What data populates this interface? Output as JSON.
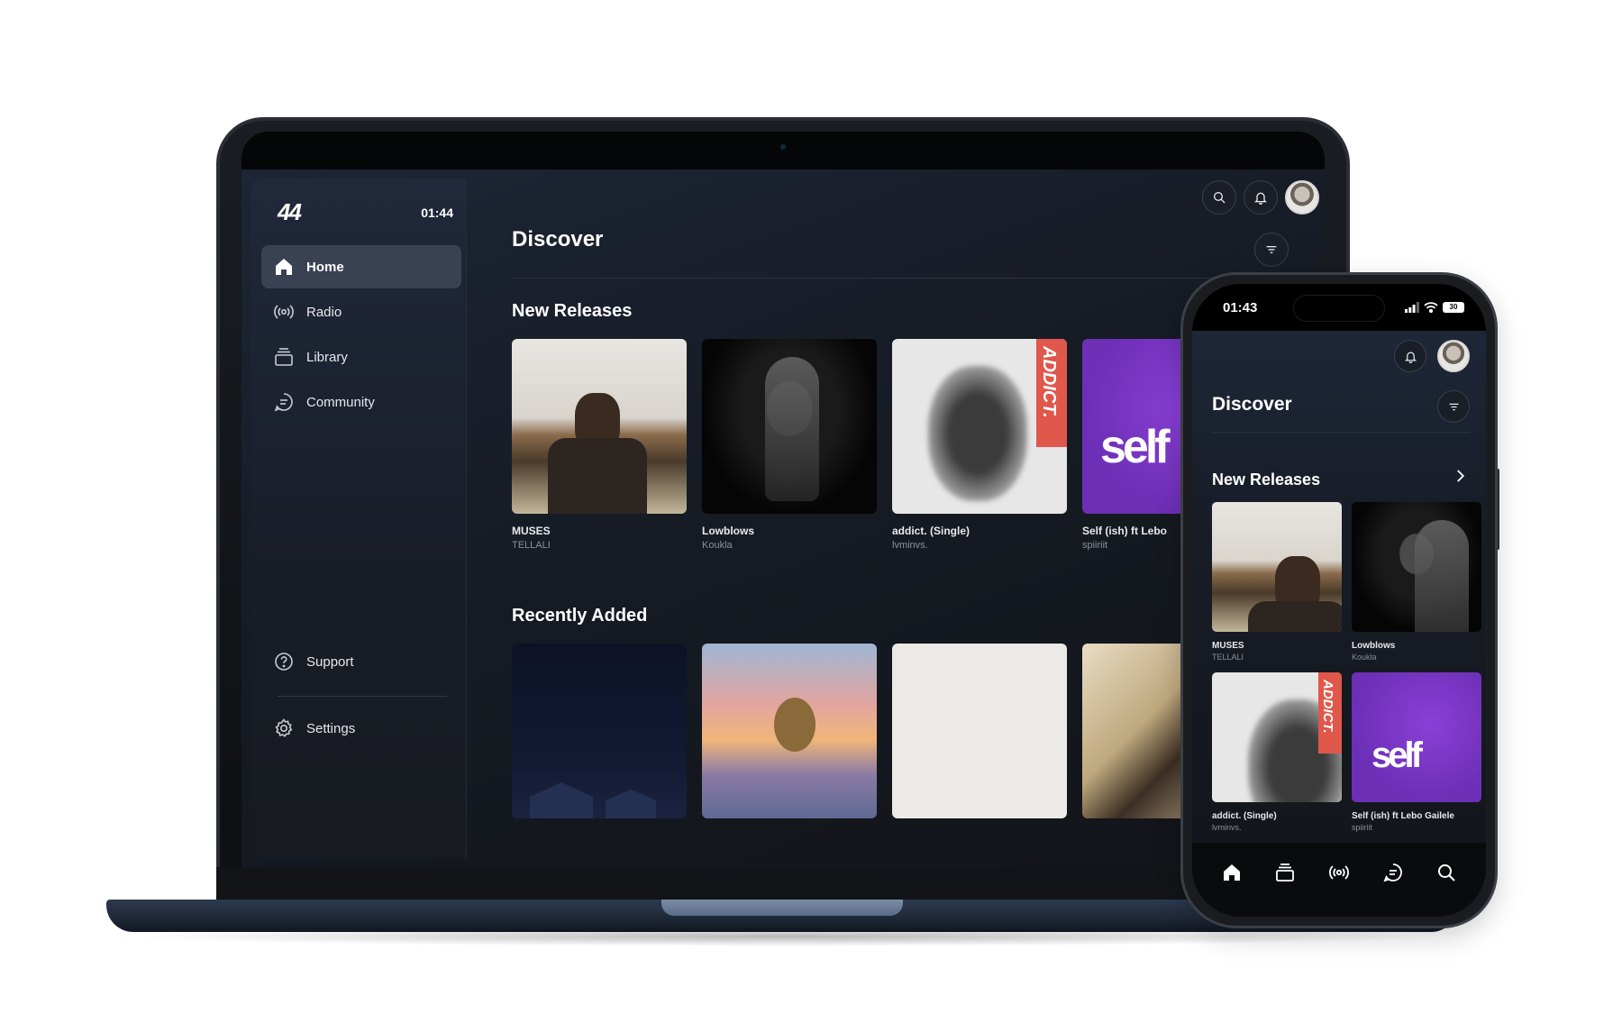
{
  "laptop": {
    "logo": "44",
    "time": "01:44",
    "nav": [
      {
        "label": "Home",
        "icon": "home-icon",
        "active": true
      },
      {
        "label": "Radio",
        "icon": "radio-icon",
        "active": false
      },
      {
        "label": "Library",
        "icon": "library-icon",
        "active": false
      },
      {
        "label": "Community",
        "icon": "community-icon",
        "active": false
      }
    ],
    "bottom_nav": [
      {
        "label": "Support",
        "icon": "help-icon"
      },
      {
        "label": "Settings",
        "icon": "gear-icon"
      }
    ],
    "page_title": "Discover",
    "sections": {
      "new_releases": {
        "title": "New Releases",
        "items": [
          {
            "title": "MUSES",
            "artist": "TELLALI"
          },
          {
            "title": "Lowblows",
            "artist": "Koukla"
          },
          {
            "title": "addict. (Single)",
            "artist": "lvminvs."
          },
          {
            "title": "Self (ish) ft Lebo",
            "artist": "spiiriit"
          }
        ]
      },
      "recently_added": {
        "title": "Recently Added"
      }
    },
    "artwork_text": {
      "addict": "ADDICT.",
      "self": "self"
    }
  },
  "phone": {
    "time": "01:43",
    "battery": "30",
    "page_title": "Discover",
    "section_title": "New Releases",
    "items": [
      {
        "title": "MUSES",
        "artist": "TELLALI"
      },
      {
        "title": "Lowblows",
        "artist": "Koukla"
      },
      {
        "title": "addict. (Single)",
        "artist": "lvminvs."
      },
      {
        "title": "Self (ish) ft Lebo Gailele",
        "artist": "spiiriit"
      }
    ],
    "tabs": [
      "home-icon",
      "library-icon",
      "radio-icon",
      "community-icon",
      "search-icon"
    ]
  },
  "colors": {
    "accent_purple": "#6c2fb6",
    "addict_red": "#e0574c",
    "active_nav": "#3a4152"
  }
}
